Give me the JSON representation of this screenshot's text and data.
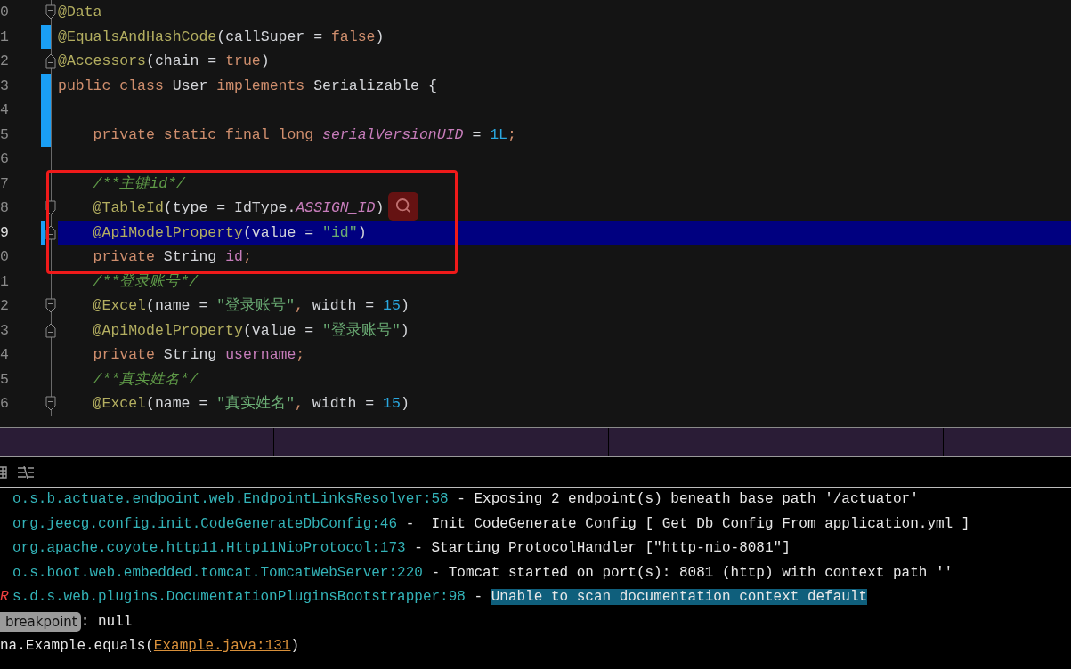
{
  "editor": {
    "lines": [
      {
        "number": "0",
        "indented": false,
        "change": false,
        "fold_open": true,
        "fold_close": false,
        "current": false,
        "tokens": [
          {
            "kind": "annotation",
            "text": "@Data"
          }
        ]
      },
      {
        "number": "1",
        "indented": false,
        "change": true,
        "fold_open": false,
        "fold_close": false,
        "current": false,
        "tokens": [
          {
            "kind": "annotation",
            "text": "@EqualsAndHashCode"
          },
          {
            "kind": "plain",
            "text": "(callSuper = "
          },
          {
            "kind": "keyword",
            "text": "false"
          },
          {
            "kind": "plain",
            "text": ")"
          }
        ]
      },
      {
        "number": "2",
        "indented": false,
        "change": false,
        "fold_open": false,
        "fold_close": true,
        "current": false,
        "tokens": [
          {
            "kind": "annotation",
            "text": "@Accessors"
          },
          {
            "kind": "plain",
            "text": "(chain = "
          },
          {
            "kind": "keyword",
            "text": "true"
          },
          {
            "kind": "plain",
            "text": ")"
          }
        ]
      },
      {
        "number": "3",
        "indented": false,
        "change": true,
        "fold_open": false,
        "fold_close": false,
        "current": false,
        "tokens": [
          {
            "kind": "keyword",
            "text": "public class "
          },
          {
            "kind": "plain",
            "text": "User "
          },
          {
            "kind": "keyword",
            "text": "implements "
          },
          {
            "kind": "plain",
            "text": "Serializable {"
          }
        ]
      },
      {
        "number": "4",
        "change": true,
        "fold_open": false,
        "fold_close": false,
        "current": false
      },
      {
        "number": "5",
        "indented": true,
        "change": true,
        "fold_open": false,
        "fold_close": false,
        "current": false,
        "tokens": [
          {
            "kind": "keyword",
            "text": "private static final long "
          },
          {
            "kind": "static",
            "text": "serialVersionUID"
          },
          {
            "kind": "plain",
            "text": " = "
          },
          {
            "kind": "number",
            "text": "1L"
          },
          {
            "kind": "keyword",
            "text": ";"
          }
        ]
      },
      {
        "number": "6",
        "change": false,
        "fold_open": false,
        "fold_close": false,
        "current": false
      },
      {
        "number": "7",
        "indented": true,
        "change": false,
        "fold_open": false,
        "fold_close": false,
        "current": false,
        "tokens": [
          {
            "kind": "comment",
            "text": "/**主键id*/"
          }
        ]
      },
      {
        "number": "8",
        "indented": true,
        "change": false,
        "fold_open": true,
        "fold_close": false,
        "current": false,
        "tokens": [
          {
            "kind": "annotation",
            "text": "@TableId"
          },
          {
            "kind": "plain",
            "text": "(type = IdType."
          },
          {
            "kind": "static",
            "text": "ASSIGN_ID"
          },
          {
            "kind": "plain",
            "text": ")"
          }
        ]
      },
      {
        "number": "9",
        "indented": true,
        "change": true,
        "fold_open": false,
        "fold_close": true,
        "current": true,
        "tokens": [
          {
            "kind": "annotation",
            "text": "@ApiModelProperty"
          },
          {
            "kind": "plain",
            "text": "(value = "
          },
          {
            "kind": "string",
            "text": "\"id\""
          },
          {
            "kind": "plain",
            "text": ")"
          }
        ]
      },
      {
        "number": "0",
        "indented": true,
        "change": false,
        "fold_open": false,
        "fold_close": false,
        "current": false,
        "tokens": [
          {
            "kind": "keyword",
            "text": "private "
          },
          {
            "kind": "plain",
            "text": "String "
          },
          {
            "kind": "field",
            "text": "id"
          },
          {
            "kind": "keyword",
            "text": ";"
          }
        ]
      },
      {
        "number": "1",
        "indented": true,
        "change": false,
        "fold_open": false,
        "fold_close": false,
        "current": false,
        "tokens": [
          {
            "kind": "comment",
            "text": "/**登录账号*/"
          }
        ]
      },
      {
        "number": "2",
        "indented": true,
        "change": false,
        "fold_open": true,
        "fold_close": false,
        "current": false,
        "tokens": [
          {
            "kind": "annotation",
            "text": "@Excel"
          },
          {
            "kind": "plain",
            "text": "(name = "
          },
          {
            "kind": "string",
            "text": "\"登录账号\""
          },
          {
            "kind": "keyword",
            "text": ", "
          },
          {
            "kind": "plain",
            "text": "width = "
          },
          {
            "kind": "number",
            "text": "15"
          },
          {
            "kind": "plain",
            "text": ")"
          }
        ]
      },
      {
        "number": "3",
        "indented": true,
        "change": false,
        "fold_open": false,
        "fold_close": true,
        "current": false,
        "tokens": [
          {
            "kind": "annotation",
            "text": "@ApiModelProperty"
          },
          {
            "kind": "plain",
            "text": "(value = "
          },
          {
            "kind": "string",
            "text": "\"登录账号\""
          },
          {
            "kind": "plain",
            "text": ")"
          }
        ]
      },
      {
        "number": "4",
        "indented": true,
        "change": false,
        "fold_open": false,
        "fold_close": false,
        "current": false,
        "tokens": [
          {
            "kind": "keyword",
            "text": "private "
          },
          {
            "kind": "plain",
            "text": "String "
          },
          {
            "kind": "field",
            "text": "username"
          },
          {
            "kind": "keyword",
            "text": ";"
          }
        ]
      },
      {
        "number": "5",
        "indented": true,
        "change": false,
        "fold_open": false,
        "fold_close": false,
        "current": false,
        "tokens": [
          {
            "kind": "comment",
            "text": "/**真实姓名*/"
          }
        ]
      },
      {
        "number": "6",
        "indented": true,
        "change": false,
        "fold_open": true,
        "fold_close": false,
        "current": false,
        "tokens": [
          {
            "kind": "annotation",
            "text": "@Excel"
          },
          {
            "kind": "plain",
            "text": "(name = "
          },
          {
            "kind": "string",
            "text": "\"真实姓名\""
          },
          {
            "kind": "keyword",
            "text": ", "
          },
          {
            "kind": "plain",
            "text": "width = "
          },
          {
            "kind": "number",
            "text": "15"
          },
          {
            "kind": "plain",
            "text": ")"
          }
        ]
      }
    ]
  },
  "console": {
    "lines": [
      {
        "kind": "log",
        "logger": "o.s.b.actuate.endpoint.web.EndpointLinksResolver:58",
        "message": " - Exposing 2 endpoint(s) beneath base path '/actuator'",
        "highlighted": false
      },
      {
        "kind": "log",
        "logger": "org.jeecg.config.init.CodeGenerateDbConfig:46",
        "message": " -  Init CodeGenerate Config [ Get Db Config From application.yml ]",
        "highlighted": false
      },
      {
        "kind": "log",
        "logger": "org.apache.coyote.http11.Http11NioProtocol:173",
        "message": " - Starting ProtocolHandler [\"http-nio-8081\"]",
        "highlighted": false
      },
      {
        "kind": "log",
        "logger": "o.s.boot.web.embedded.tomcat.TomcatWebServer:220",
        "message": " - Tomcat started on port(s): 8081 (http) with context path ''",
        "highlighted": false
      },
      {
        "kind": "log",
        "level": "R",
        "logger": "s.d.s.web.plugins.DocumentationPluginsBootstrapper:98",
        "separator": " - ",
        "message": "Unable to scan documentation context default",
        "highlighted": true
      },
      {
        "kind": "breakpoint",
        "badge": "breakpoint",
        "text": ": null"
      },
      {
        "kind": "trace",
        "before": "na.Example.equals(",
        "link": "Example.java:131",
        "after": ")"
      }
    ]
  }
}
